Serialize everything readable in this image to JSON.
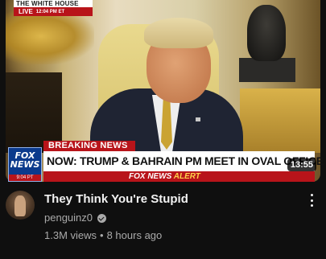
{
  "video": {
    "thumbnail": {
      "bug_title": "THE WHITE HOUSE",
      "bug_live": "LIVE",
      "bug_time": "12:04 PM ET",
      "logo_text": "FOX NEWS",
      "logo_time": "9:04 PT",
      "breaking_label": "BREAKING NEWS",
      "headline": "NOW: TRUMP & BAHRAIN PM MEET IN OVAL OFFICE",
      "alert_prefix": "FOX NEWS",
      "alert_suffix": "ALERT",
      "duration": "13:55"
    },
    "title": "They Think You're Stupid",
    "channel": "penguinz0",
    "views": "1.3M views",
    "separator": "•",
    "age": "8 hours ago"
  },
  "icons": {
    "verified": "verified-badge-icon",
    "more": "more-vertical-icon"
  },
  "colors": {
    "background": "#0f0f0f",
    "title": "#f1f1f1",
    "secondary_text": "#aaaaaa",
    "fox_red": "#b8141a"
  }
}
